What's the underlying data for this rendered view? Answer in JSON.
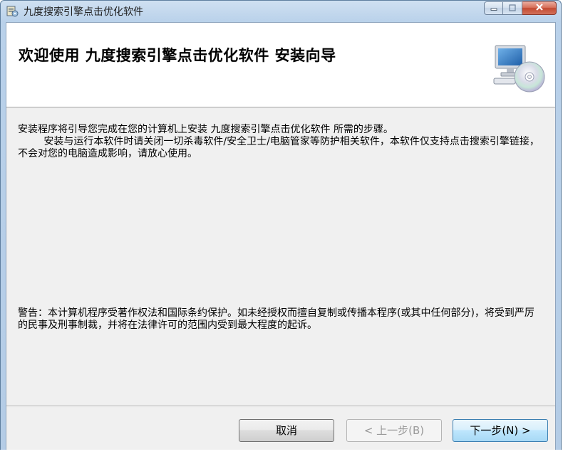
{
  "window": {
    "title": "九度搜索引擎点击优化软件",
    "icon": "installer-icon",
    "controls": {
      "minimize": "minimize-icon",
      "maximize": "maximize-icon",
      "close": "close-icon"
    }
  },
  "banner": {
    "title": "欢迎使用  九度搜索引擎点击优化软件  安装向导",
    "graphic": "computer-cd-icon"
  },
  "body": {
    "paragraph1": "安装程序将引导您完成在您的计算机上安装 九度搜索引擎点击优化软件 所需的步骤。",
    "paragraph2": "安装与运行本软件时请关闭一切杀毒软件/安全卫士/电脑管家等防护相关软件，本软件仅支持点击搜索引擎链接，不会对您的电脑造成影响，请放心使用。",
    "warning": "警告：本计算机程序受著作权法和国际条约保护。如未经授权而擅自复制或传播本程序(或其中任何部分)，将受到严厉的民事及刑事制裁，并将在法律许可的范围内受到最大程度的起诉。"
  },
  "buttons": {
    "cancel": "取消",
    "back": "< 上一步(B)",
    "next": "下一步(N) >"
  },
  "colors": {
    "titlebar": "#b9d1ea",
    "dialog_bg": "#f0f0f0",
    "banner_bg": "#ffffff",
    "close_button": "#c24a31",
    "next_button_border": "#3c7fb1"
  }
}
